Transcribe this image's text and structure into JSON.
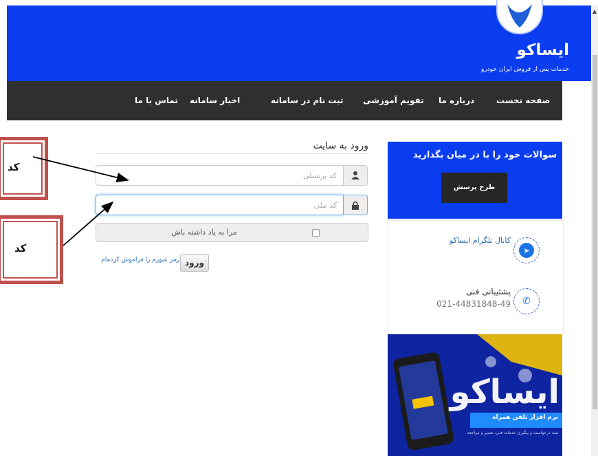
{
  "header": {
    "logo_word": "ایساکو",
    "logo_tagline": "خدمات پس از فروش ایران خودرو"
  },
  "nav": {
    "items": [
      "صفحه نخست",
      "درباره ما",
      "تقویم آموزشی",
      "ثبت نام در سامانه",
      "اخبار سامانه",
      "تماس با ما"
    ]
  },
  "login": {
    "title": "ورود به سایت",
    "personnel_placeholder": "کد پرسنلی",
    "national_placeholder": "کد ملی",
    "remember_label": "مرا به یاد داشته باش",
    "submit_label": "ورود",
    "forgot_label": "رمز عبورم را فراموش کردمام"
  },
  "annotations": {
    "note1": "کد",
    "note2": "کد"
  },
  "sidebar": {
    "ask_text": "سوالات خود را با در میان بگذارید",
    "ask_button": "طرح پرسش",
    "telegram_label": "کانال تلگرام ایساکو",
    "support_label": "پشتیبانی فنی",
    "support_phone": "021-44831848-49"
  },
  "banner": {
    "word": "ایساکو",
    "strip_text": "نرم افزار تلفن همراه",
    "strip_subtext": "ثبت درخواست و پیگیری خدمات فنی، تعمیر و مراجعه"
  },
  "colors": {
    "brand_blue": "#0a3cf0",
    "nav_dark": "#2f2f2f",
    "annotation_red": "#c0504d",
    "focus_blue": "#66afe9"
  }
}
